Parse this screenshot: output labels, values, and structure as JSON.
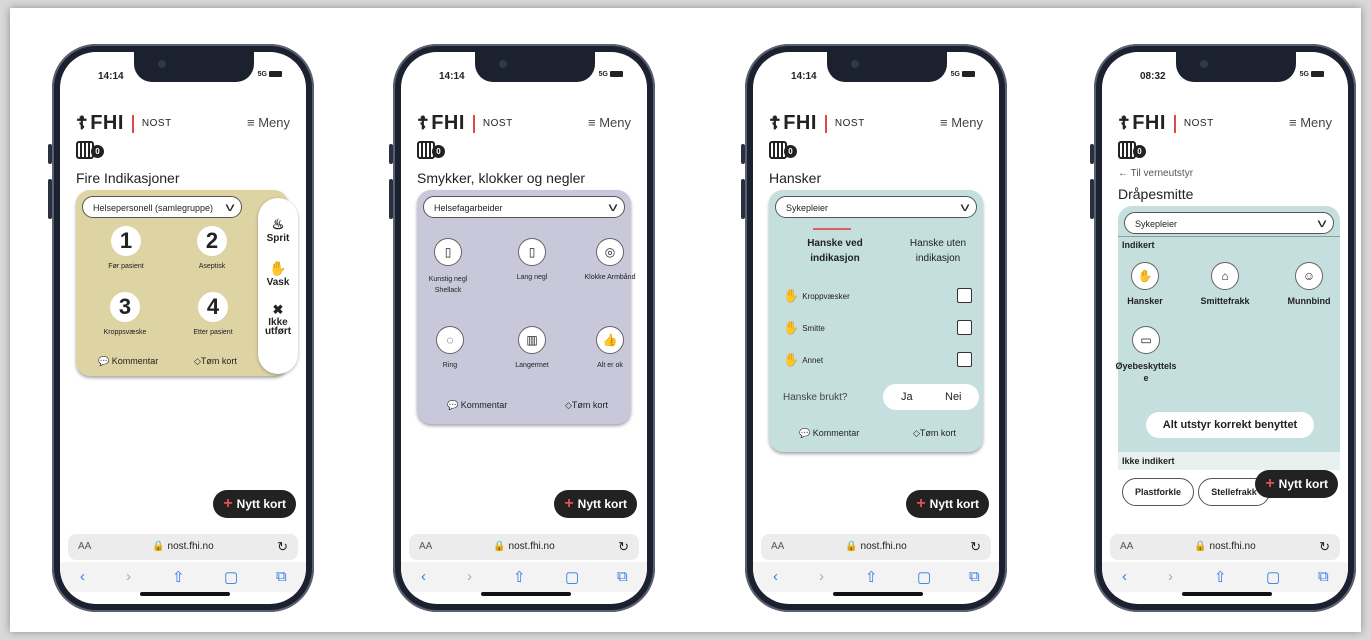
{
  "phones": [
    {
      "time": "14:14",
      "signal": "5G",
      "brand": "FHI",
      "brand_sub": "NOST",
      "menu": "≡ Meny",
      "card_count": "0",
      "title": "Fire Indikasjoner",
      "panel_color": "#ddd3a3",
      "select": "Helsepersonell (samlegruppe)",
      "indications": [
        {
          "num": "1",
          "label": "Før pasient"
        },
        {
          "num": "2",
          "label": "Aseptisk"
        },
        {
          "num": "3",
          "label": "Kroppsvæske"
        },
        {
          "num": "4",
          "label": "Etter pasient"
        }
      ],
      "actions": [
        {
          "icon": "hand-sanitizer-icon",
          "glyph": "♨",
          "label": "Sprit"
        },
        {
          "icon": "hand-wash-icon",
          "glyph": "✋",
          "label": "Vask"
        },
        {
          "icon": "not-done-icon",
          "glyph": "✖",
          "label": "Ikke utført"
        }
      ],
      "comment": "Kommentar",
      "clear": "Tøm kort",
      "new_card": "Nytt kort",
      "aa": "AA",
      "url": "🔒 nost.fhi.no"
    },
    {
      "time": "14:14",
      "signal": "5G",
      "brand": "FHI",
      "brand_sub": "NOST",
      "menu": "≡ Meny",
      "card_count": "0",
      "title": "Smykker, klokker og negler",
      "panel_color": "#c8c8da",
      "select": "Helsefagarbeider",
      "items": [
        {
          "icon": "artificial-nail-icon",
          "glyph": "▯",
          "label": "Kunstig negl Shellack"
        },
        {
          "icon": "long-nail-icon",
          "glyph": "▯",
          "label": "Lang negl"
        },
        {
          "icon": "watch-icon",
          "glyph": "◎",
          "label": "Klokke Armbånd"
        },
        {
          "icon": "ring-icon",
          "glyph": "◌",
          "label": "Ring"
        },
        {
          "icon": "long-sleeve-icon",
          "glyph": "▥",
          "label": "Langermet"
        },
        {
          "icon": "thumbs-up-icon",
          "glyph": "👍",
          "label": "Alt er ok"
        }
      ],
      "comment": "Kommentar",
      "clear": "Tøm kort",
      "new_card": "Nytt kort",
      "aa": "AA",
      "url": "🔒 nost.fhi.no"
    },
    {
      "time": "14:14",
      "signal": "5G",
      "brand": "FHI",
      "brand_sub": "NOST",
      "menu": "≡ Meny",
      "card_count": "0",
      "title": "Hansker",
      "panel_color": "#c5dfdf",
      "select": "Sykepleier",
      "tab_with": "Hanske ved indikasjon",
      "tab_without": "Hanske uten indikasjon",
      "checks": [
        {
          "label": "Kroppvæsker"
        },
        {
          "label": "Smitte"
        },
        {
          "label": "Annet"
        }
      ],
      "glove_used": "Hanske brukt?",
      "yes": "Ja",
      "no": "Nei",
      "comment": "Kommentar",
      "clear": "Tøm kort",
      "new_card": "Nytt kort",
      "aa": "AA",
      "url": "🔒 nost.fhi.no"
    },
    {
      "time": "08:32",
      "signal": "5G",
      "brand": "FHI",
      "brand_sub": "NOST",
      "menu": "≡ Meny",
      "card_count": "0",
      "back": "← Til verneutstyr",
      "title": "Dråpesmitte",
      "panel_color": "#c5dfdf",
      "select": "Sykepleier",
      "indicated_header": "Indikert",
      "indicated": [
        {
          "icon": "glove-icon",
          "glyph": "✋",
          "label": "Hansker"
        },
        {
          "icon": "gown-icon",
          "glyph": "⌂",
          "label": "Smittefrakk"
        },
        {
          "icon": "mask-icon",
          "glyph": "☺",
          "label": "Munnbind"
        },
        {
          "icon": "goggles-icon",
          "glyph": "▭",
          "label": "Øyebeskyttels e"
        }
      ],
      "all_correct": "Alt utstyr korrekt benyttet",
      "not_indicated_header": "Ikke indikert",
      "not_indicated": [
        "Plastforkle",
        "Stellefrakk"
      ],
      "new_card": "Nytt kort",
      "aa": "AA",
      "url": "🔒 nost.fhi.no"
    }
  ],
  "nav_icons": [
    "‹",
    "›",
    "⇧",
    "▢",
    "⧉"
  ]
}
